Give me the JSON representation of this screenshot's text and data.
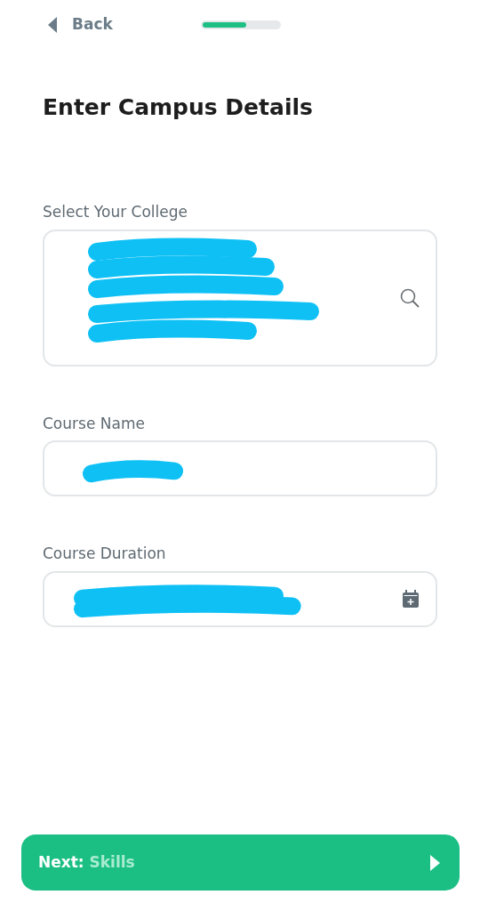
{
  "header": {
    "back_label": "Back",
    "progress": {
      "level": 0.57
    }
  },
  "title": "Enter Campus Details",
  "fields": [
    {
      "label": "Select Your College",
      "kind": "search",
      "redacted": true
    },
    {
      "label": "Course Name",
      "kind": "text",
      "redacted": true
    },
    {
      "label": "Course Duration",
      "kind": "date",
      "redacted": true
    }
  ],
  "next_button": {
    "prefix": "Next:",
    "target": "Skills"
  }
}
